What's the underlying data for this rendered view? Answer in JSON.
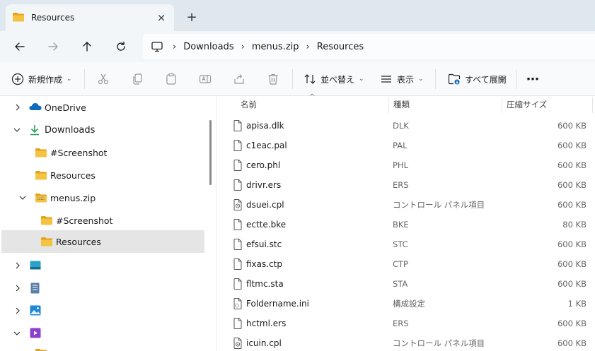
{
  "colors": {
    "folder": "#f5c342",
    "folder_dark": "#e3a21a",
    "accent": "#0067c0",
    "onedrive": "#0f6cbd",
    "downloads": "#2c9e5a",
    "selection": "#e5e5e5"
  },
  "tab": {
    "title": "Resources",
    "close_icon": "×",
    "new_tab_icon": "+"
  },
  "breadcrumb": [
    "Downloads",
    "menus.zip",
    "Resources"
  ],
  "breadcrumb_sep": "›",
  "toolbar": {
    "new_label": "新規作成",
    "sort_label": "並べ替え",
    "view_label": "表示",
    "expand_label": "すべて展開",
    "more_label": "⋯",
    "chevron": "⌄"
  },
  "nav_tree": [
    {
      "label": "OneDrive",
      "icon": "onedrive-icon",
      "expanded": false
    },
    {
      "label": "Downloads",
      "icon": "download-icon",
      "expanded": true
    },
    {
      "label": "#Screenshot",
      "icon": "folder-icon"
    },
    {
      "label": "Resources",
      "icon": "folder-icon"
    },
    {
      "label": "menus.zip",
      "icon": "zip-folder-icon",
      "expanded": true
    },
    {
      "label": "#Screenshot",
      "icon": "folder-icon"
    },
    {
      "label": "Resources",
      "icon": "folder-icon",
      "selected": true
    },
    {
      "label": "",
      "icon": "desktop-icon",
      "expanded": false
    },
    {
      "label": "",
      "icon": "documents-icon",
      "expanded": false
    },
    {
      "label": "",
      "icon": "pictures-icon",
      "expanded": false
    },
    {
      "label": "",
      "icon": "videos-icon",
      "expanded": true
    }
  ],
  "columns": {
    "name": "名前",
    "type": "種類",
    "size": "圧縮サイズ"
  },
  "files": [
    {
      "name": "apisa.dlk",
      "type": "DLK",
      "size": "600 KB",
      "icon": "file-icon"
    },
    {
      "name": "c1eac.pal",
      "type": "PAL",
      "size": "600 KB",
      "icon": "file-icon"
    },
    {
      "name": "cero.phl",
      "type": "PHL",
      "size": "600 KB",
      "icon": "file-icon"
    },
    {
      "name": "drivr.ers",
      "type": "ERS",
      "size": "600 KB",
      "icon": "file-icon"
    },
    {
      "name": "dsuei.cpl",
      "type": "コントロール パネル項目",
      "size": "600 KB",
      "icon": "control-panel-file-icon"
    },
    {
      "name": "ectte.bke",
      "type": "BKE",
      "size": "80 KB",
      "icon": "file-icon"
    },
    {
      "name": "efsui.stc",
      "type": "STC",
      "size": "600 KB",
      "icon": "file-icon"
    },
    {
      "name": "fixas.ctp",
      "type": "CTP",
      "size": "600 KB",
      "icon": "file-icon"
    },
    {
      "name": "fltmc.sta",
      "type": "STA",
      "size": "600 KB",
      "icon": "file-icon"
    },
    {
      "name": "Foldername.ini",
      "type": "構成設定",
      "size": "1 KB",
      "icon": "settings-file-icon"
    },
    {
      "name": "hctml.ers",
      "type": "ERS",
      "size": "600 KB",
      "icon": "file-icon"
    },
    {
      "name": "icuin.cpl",
      "type": "コントロール パネル項目",
      "size": "600 KB",
      "icon": "control-panel-file-icon"
    }
  ]
}
